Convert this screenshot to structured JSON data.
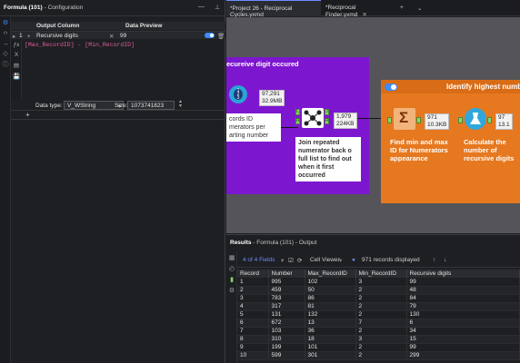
{
  "config": {
    "title_bold": "Formula (101)",
    "title_rest": "- Configuration",
    "grid": {
      "col_output": "Output Column",
      "col_preview": "Data Preview",
      "row_index": "1",
      "row_field": "Recursive digits",
      "row_preview": "99"
    },
    "expression": "[Max_RecordID] - [Min_RecordID]",
    "data_type_label": "Data type:",
    "data_type_value": "V_WString",
    "size_label": "Size:",
    "size_value": "1073741823"
  },
  "tabs": [
    {
      "label": "*Project 26 - Reciprocal Cycles.yxmd",
      "active": true
    },
    {
      "label": "*Reciprocal Finder.yxmd",
      "active": false
    }
  ],
  "canvas": {
    "purple_container_title": "ecureive digit occured",
    "orange_container_title": "Identify highest numb",
    "tool_a_stats": {
      "records": "97,291",
      "size": "32.9MB"
    },
    "tool_b_stats": {
      "records": "1,979",
      "size": "224KB"
    },
    "tool_c_stats": {
      "records": "971",
      "size": "10.3KB"
    },
    "tool_d_stats": {
      "records": "97",
      "size": "13.1"
    },
    "note_a": "cords ID\nmerators per\narting number",
    "note_b": "Join repeated numerator back o full list to find out when it first occurred",
    "note_c": "Find min and max ID for Numerators appearance",
    "note_d": "Calculate the number of recursive digits"
  },
  "results": {
    "title_bold": "Results",
    "title_rest": "- Formula (101) - Output",
    "fields_label": "4 of 4 Fields",
    "viewer_label": "Cell Viewer",
    "records_label": "971 records displayed",
    "columns": [
      "Record",
      "Number",
      "Max_RecordID",
      "Min_RecordID",
      "Recursive digits"
    ],
    "rows": [
      [
        "1",
        "995",
        "102",
        "3",
        "99"
      ],
      [
        "2",
        "459",
        "50",
        "2",
        "48"
      ],
      [
        "3",
        "783",
        "86",
        "2",
        "84"
      ],
      [
        "4",
        "317",
        "81",
        "2",
        "79"
      ],
      [
        "5",
        "131",
        "132",
        "2",
        "130"
      ],
      [
        "6",
        "672",
        "13",
        "7",
        "6"
      ],
      [
        "7",
        "103",
        "36",
        "2",
        "34"
      ],
      [
        "8",
        "310",
        "18",
        "3",
        "15"
      ],
      [
        "9",
        "199",
        "101",
        "2",
        "99"
      ],
      [
        "10",
        "599",
        "301",
        "2",
        "299"
      ]
    ]
  }
}
